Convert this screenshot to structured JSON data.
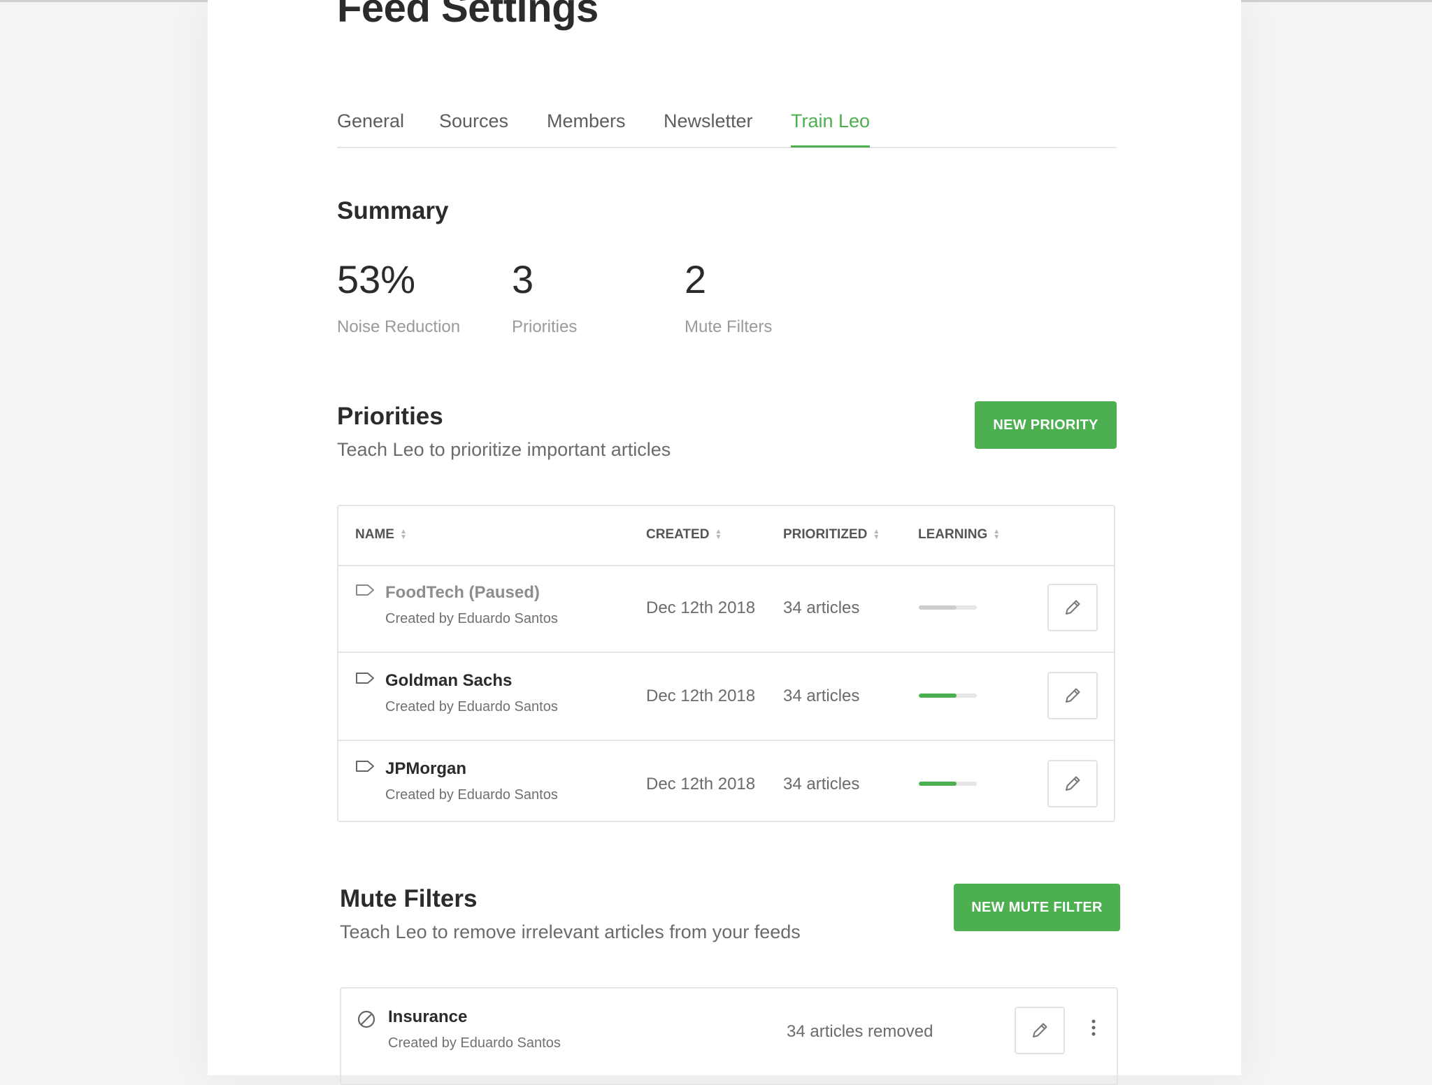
{
  "page_title": "Feed Settings",
  "tabs": [
    {
      "label": "General"
    },
    {
      "label": "Sources"
    },
    {
      "label": "Members"
    },
    {
      "label": "Newsletter"
    },
    {
      "label": "Train Leo",
      "active": true
    }
  ],
  "summary": {
    "title": "Summary",
    "stats": [
      {
        "value": "53%",
        "label": "Noise Reduction"
      },
      {
        "value": "3",
        "label": "Priorities"
      },
      {
        "value": "2",
        "label": "Mute Filters"
      }
    ]
  },
  "priorities": {
    "title": "Priorities",
    "subtitle": "Teach Leo to prioritize important articles",
    "new_button": "NEW PRIORITY",
    "columns": {
      "name": "NAME",
      "created": "CREATED",
      "prioritized": "PRIORITIZED",
      "learning": "LEARNING"
    },
    "rows": [
      {
        "name": "FoodTech (Paused)",
        "created_by": "Created by Eduardo Santos",
        "created": "Dec 12th 2018",
        "prioritized": "34 articles",
        "learning": 0.65,
        "paused": true
      },
      {
        "name": "Goldman Sachs",
        "created_by": "Created by Eduardo Santos",
        "created": "Dec 12th 2018",
        "prioritized": "34 articles",
        "learning": 0.65,
        "paused": false
      },
      {
        "name": "JPMorgan",
        "created_by": "Created by Eduardo Santos",
        "created": "Dec 12th 2018",
        "prioritized": "34 articles",
        "learning": 0.65,
        "paused": false
      }
    ]
  },
  "mute_filters": {
    "title": "Mute Filters",
    "subtitle": "Teach Leo to remove irrelevant articles from your feeds",
    "new_button": "NEW MUTE FILTER",
    "rows": [
      {
        "name": "Insurance",
        "created_by": "Created by Eduardo Santos",
        "removed": "34 articles removed"
      }
    ]
  },
  "icons": {
    "row": "tag-icon",
    "mute": "ban-icon",
    "edit": "pencil-icon",
    "more": "more-vertical-icon",
    "sort": "sort-icon"
  },
  "colors": {
    "accent": "#4caf50",
    "paused_bar": "#cccccc",
    "track": "#e6e6e6"
  }
}
